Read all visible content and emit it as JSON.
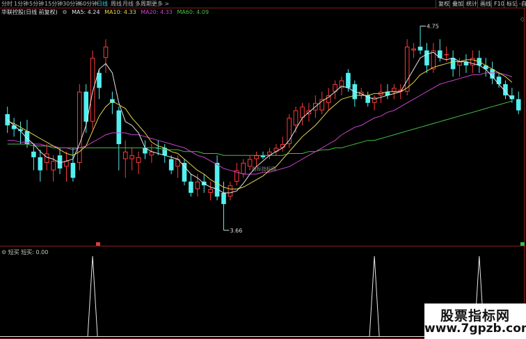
{
  "toolbar": {
    "left_items": [
      {
        "label": "分时",
        "active": false
      },
      {
        "label": "1分钟",
        "active": false
      },
      {
        "label": "5分钟",
        "active": false
      },
      {
        "label": "15分钟",
        "active": false
      },
      {
        "label": "30分钟",
        "active": false
      },
      {
        "label": "60分钟",
        "active": false
      },
      {
        "label": "日线",
        "active": true
      },
      {
        "label": "周线",
        "active": false
      },
      {
        "label": "月线",
        "active": false
      },
      {
        "label": "多周期",
        "active": false
      },
      {
        "label": "更多 >",
        "active": false
      }
    ],
    "right_items": [
      "复权",
      "叠加",
      "统计",
      "画线",
      "F10",
      "标记",
      "-自"
    ]
  },
  "stock": {
    "title": "华联控股(日线 前复权)",
    "ma5": "MA5: 4.24",
    "ma10": "MA10: 4.33",
    "ma20": "MA20: 4.33",
    "ma60": "MA60: 4.09",
    "high_mark": "4.75",
    "low_mark": "3.66"
  },
  "colors": {
    "up": "#ff3b3b",
    "down": "#52f0f0",
    "ma5": "#e6e6e6",
    "ma10": "#e6d84a",
    "ma20": "#cc44cc",
    "ma60": "#44c044",
    "grid": "#8b1a1a"
  },
  "indicator": {
    "name": "短买",
    "legend": "短买: 0.00"
  },
  "watermark_center": "股标指标网",
  "logo": {
    "line1": "股票指标网",
    "line2": "www.7gpzb.com"
  },
  "price_chart": {
    "y_range": [
      3.6,
      4.8
    ],
    "candles": [
      {
        "o": 4.28,
        "h": 4.32,
        "l": 4.18,
        "c": 4.22,
        "up": false
      },
      {
        "o": 4.22,
        "h": 4.26,
        "l": 4.16,
        "c": 4.2,
        "up": false
      },
      {
        "o": 4.2,
        "h": 4.24,
        "l": 4.12,
        "c": 4.19,
        "up": false
      },
      {
        "o": 4.19,
        "h": 4.25,
        "l": 4.1,
        "c": 4.12,
        "up": false
      },
      {
        "o": 4.08,
        "h": 4.12,
        "l": 3.98,
        "c": 4.05,
        "up": false
      },
      {
        "o": 4.05,
        "h": 4.09,
        "l": 3.92,
        "c": 3.98,
        "up": false
      },
      {
        "o": 4.02,
        "h": 4.12,
        "l": 3.98,
        "c": 4.07,
        "up": true
      },
      {
        "o": 3.98,
        "h": 4.06,
        "l": 3.92,
        "c": 4.03,
        "up": true
      },
      {
        "o": 4.06,
        "h": 4.1,
        "l": 3.96,
        "c": 3.99,
        "up": false
      },
      {
        "o": 4.0,
        "h": 4.08,
        "l": 3.92,
        "c": 4.03,
        "up": true
      },
      {
        "o": 4.02,
        "h": 4.1,
        "l": 3.92,
        "c": 3.94,
        "up": false
      },
      {
        "o": 4.02,
        "h": 4.44,
        "l": 3.98,
        "c": 4.4,
        "up": true
      },
      {
        "o": 4.4,
        "h": 4.44,
        "l": 4.18,
        "c": 4.24,
        "up": false
      },
      {
        "o": 4.24,
        "h": 4.62,
        "l": 4.2,
        "c": 4.58,
        "up": true
      },
      {
        "o": 4.5,
        "h": 4.52,
        "l": 4.36,
        "c": 4.42,
        "up": false
      },
      {
        "o": 4.58,
        "h": 4.68,
        "l": 4.5,
        "c": 4.64,
        "up": true
      },
      {
        "o": 4.36,
        "h": 4.4,
        "l": 4.28,
        "c": 4.34,
        "up": false
      },
      {
        "o": 4.3,
        "h": 4.32,
        "l": 3.98,
        "c": 4.12,
        "up": false
      },
      {
        "o": 4.08,
        "h": 4.14,
        "l": 3.94,
        "c": 4.04,
        "up": true
      },
      {
        "o": 4.04,
        "h": 4.1,
        "l": 3.98,
        "c": 4.06,
        "up": true
      },
      {
        "o": 4.02,
        "h": 4.08,
        "l": 3.96,
        "c": 4.05,
        "up": true
      },
      {
        "o": 4.1,
        "h": 4.14,
        "l": 4.04,
        "c": 4.07,
        "up": false
      },
      {
        "o": 4.06,
        "h": 4.12,
        "l": 4.02,
        "c": 4.08,
        "up": true
      },
      {
        "o": 4.1,
        "h": 4.14,
        "l": 4.06,
        "c": 4.1,
        "up": false
      },
      {
        "o": 4.1,
        "h": 4.12,
        "l": 4.02,
        "c": 4.06,
        "up": false
      },
      {
        "o": 4.04,
        "h": 4.06,
        "l": 3.96,
        "c": 3.98,
        "up": false
      },
      {
        "o": 4.0,
        "h": 4.06,
        "l": 3.94,
        "c": 4.04,
        "up": true
      },
      {
        "o": 4.02,
        "h": 4.04,
        "l": 3.9,
        "c": 3.92,
        "up": false
      },
      {
        "o": 3.92,
        "h": 3.96,
        "l": 3.84,
        "c": 3.86,
        "up": false
      },
      {
        "o": 3.88,
        "h": 3.96,
        "l": 3.84,
        "c": 3.92,
        "up": true
      },
      {
        "o": 3.92,
        "h": 3.96,
        "l": 3.86,
        "c": 3.9,
        "up": false
      },
      {
        "o": 3.88,
        "h": 3.92,
        "l": 3.82,
        "c": 3.86,
        "up": true
      },
      {
        "o": 4.02,
        "h": 4.06,
        "l": 3.82,
        "c": 3.84,
        "up": false
      },
      {
        "o": 3.86,
        "h": 3.92,
        "l": 3.66,
        "c": 3.8,
        "up": false
      },
      {
        "o": 3.84,
        "h": 3.92,
        "l": 3.82,
        "c": 3.9,
        "up": true
      },
      {
        "o": 3.92,
        "h": 4.02,
        "l": 3.9,
        "c": 3.98,
        "up": true
      },
      {
        "o": 3.96,
        "h": 4.04,
        "l": 3.94,
        "c": 4.02,
        "up": true
      },
      {
        "o": 4.0,
        "h": 4.06,
        "l": 3.98,
        "c": 4.04,
        "up": true
      },
      {
        "o": 4.04,
        "h": 4.08,
        "l": 4.0,
        "c": 4.06,
        "up": true
      },
      {
        "o": 4.06,
        "h": 4.08,
        "l": 4.04,
        "c": 4.05,
        "up": false
      },
      {
        "o": 4.06,
        "h": 4.1,
        "l": 4.04,
        "c": 4.08,
        "up": true
      },
      {
        "o": 4.08,
        "h": 4.12,
        "l": 4.06,
        "c": 4.1,
        "up": true
      },
      {
        "o": 4.1,
        "h": 4.16,
        "l": 4.08,
        "c": 4.12,
        "up": true
      },
      {
        "o": 4.12,
        "h": 4.28,
        "l": 4.1,
        "c": 4.26,
        "up": true
      },
      {
        "o": 4.22,
        "h": 4.32,
        "l": 4.18,
        "c": 4.3,
        "up": true
      },
      {
        "o": 4.26,
        "h": 4.34,
        "l": 4.22,
        "c": 4.32,
        "up": true
      },
      {
        "o": 4.28,
        "h": 4.34,
        "l": 4.24,
        "c": 4.3,
        "up": true
      },
      {
        "o": 4.3,
        "h": 4.38,
        "l": 4.26,
        "c": 4.34,
        "up": true
      },
      {
        "o": 4.3,
        "h": 4.4,
        "l": 4.28,
        "c": 4.36,
        "up": true
      },
      {
        "o": 4.34,
        "h": 4.42,
        "l": 4.3,
        "c": 4.38,
        "up": true
      },
      {
        "o": 4.4,
        "h": 4.46,
        "l": 4.36,
        "c": 4.44,
        "up": true
      },
      {
        "o": 4.42,
        "h": 4.48,
        "l": 4.38,
        "c": 4.46,
        "up": true
      },
      {
        "o": 4.5,
        "h": 4.52,
        "l": 4.4,
        "c": 4.42,
        "up": false
      },
      {
        "o": 4.44,
        "h": 4.46,
        "l": 4.32,
        "c": 4.36,
        "up": false
      },
      {
        "o": 4.4,
        "h": 4.42,
        "l": 4.36,
        "c": 4.38,
        "up": true
      },
      {
        "o": 4.38,
        "h": 4.4,
        "l": 4.32,
        "c": 4.34,
        "up": false
      },
      {
        "o": 4.34,
        "h": 4.38,
        "l": 4.3,
        "c": 4.37,
        "up": true
      },
      {
        "o": 4.38,
        "h": 4.44,
        "l": 4.34,
        "c": 4.4,
        "up": true
      },
      {
        "o": 4.4,
        "h": 4.44,
        "l": 4.36,
        "c": 4.38,
        "up": false
      },
      {
        "o": 4.4,
        "h": 4.44,
        "l": 4.36,
        "c": 4.42,
        "up": true
      },
      {
        "o": 4.4,
        "h": 4.44,
        "l": 4.36,
        "c": 4.41,
        "up": true
      },
      {
        "o": 4.4,
        "h": 4.68,
        "l": 4.38,
        "c": 4.64,
        "up": true
      },
      {
        "o": 4.62,
        "h": 4.66,
        "l": 4.58,
        "c": 4.63,
        "up": true
      },
      {
        "o": 4.64,
        "h": 4.75,
        "l": 4.6,
        "c": 4.62,
        "up": false
      },
      {
        "o": 4.62,
        "h": 4.66,
        "l": 4.5,
        "c": 4.54,
        "up": false
      },
      {
        "o": 4.52,
        "h": 4.66,
        "l": 4.5,
        "c": 4.62,
        "up": true
      },
      {
        "o": 4.62,
        "h": 4.68,
        "l": 4.56,
        "c": 4.58,
        "up": false
      },
      {
        "o": 4.6,
        "h": 4.64,
        "l": 4.56,
        "c": 4.6,
        "up": true
      },
      {
        "o": 4.58,
        "h": 4.62,
        "l": 4.48,
        "c": 4.52,
        "up": false
      },
      {
        "o": 4.54,
        "h": 4.58,
        "l": 4.48,
        "c": 4.56,
        "up": true
      },
      {
        "o": 4.56,
        "h": 4.6,
        "l": 4.5,
        "c": 4.54,
        "up": false
      },
      {
        "o": 4.54,
        "h": 4.62,
        "l": 4.5,
        "c": 4.58,
        "up": true
      },
      {
        "o": 4.58,
        "h": 4.62,
        "l": 4.5,
        "c": 4.54,
        "up": false
      },
      {
        "o": 4.54,
        "h": 4.58,
        "l": 4.48,
        "c": 4.52,
        "up": false
      },
      {
        "o": 4.52,
        "h": 4.56,
        "l": 4.44,
        "c": 4.47,
        "up": false
      },
      {
        "o": 4.48,
        "h": 4.5,
        "l": 4.42,
        "c": 4.44,
        "up": false
      },
      {
        "o": 4.44,
        "h": 4.46,
        "l": 4.36,
        "c": 4.38,
        "up": false
      },
      {
        "o": 4.38,
        "h": 4.42,
        "l": 4.34,
        "c": 4.36,
        "up": false
      },
      {
        "o": 4.36,
        "h": 4.4,
        "l": 4.28,
        "c": 4.3,
        "up": false
      }
    ],
    "ma5": [
      4.25,
      4.22,
      4.19,
      4.15,
      4.12,
      4.08,
      4.05,
      4.04,
      4.02,
      4.03,
      4.04,
      4.12,
      4.22,
      4.4,
      4.52,
      4.55,
      4.5,
      4.34,
      4.24,
      4.22,
      4.18,
      4.1,
      4.08,
      4.07,
      4.06,
      4.05,
      4.04,
      4.0,
      3.96,
      3.94,
      3.91,
      3.89,
      3.88,
      3.86,
      3.86,
      3.87,
      3.91,
      3.96,
      4.0,
      4.03,
      4.06,
      4.08,
      4.1,
      4.14,
      4.2,
      4.26,
      4.29,
      4.32,
      4.35,
      4.37,
      4.4,
      4.43,
      4.42,
      4.4,
      4.39,
      4.37,
      4.36,
      4.37,
      4.38,
      4.39,
      4.4,
      4.46,
      4.52,
      4.58,
      4.6,
      4.61,
      4.58,
      4.57,
      4.58,
      4.56,
      4.56,
      4.55,
      4.54,
      4.52,
      4.48,
      4.44,
      4.4,
      4.36
    ],
    "ma10": [
      4.24,
      4.23,
      4.21,
      4.19,
      4.17,
      4.15,
      4.13,
      4.11,
      4.09,
      4.07,
      4.06,
      4.08,
      4.11,
      4.19,
      4.27,
      4.32,
      4.35,
      4.33,
      4.31,
      4.26,
      4.22,
      4.18,
      4.13,
      4.11,
      4.1,
      4.08,
      4.07,
      4.04,
      4.01,
      3.98,
      3.96,
      3.93,
      3.91,
      3.89,
      3.88,
      3.88,
      3.89,
      3.91,
      3.93,
      3.95,
      3.98,
      4.0,
      4.04,
      4.08,
      4.12,
      4.16,
      4.19,
      4.22,
      4.26,
      4.3,
      4.33,
      4.36,
      4.37,
      4.38,
      4.38,
      4.38,
      4.39,
      4.39,
      4.4,
      4.4,
      4.4,
      4.42,
      4.45,
      4.49,
      4.51,
      4.53,
      4.54,
      4.55,
      4.56,
      4.56,
      4.57,
      4.57,
      4.56,
      4.54,
      4.52,
      4.5,
      4.48,
      4.45
    ],
    "ma20": [
      4.14,
      4.14,
      4.13,
      4.13,
      4.12,
      4.12,
      4.11,
      4.11,
      4.1,
      4.1,
      4.09,
      4.1,
      4.11,
      4.13,
      4.15,
      4.17,
      4.18,
      4.18,
      4.18,
      4.17,
      4.17,
      4.16,
      4.15,
      4.14,
      4.13,
      4.12,
      4.11,
      4.1,
      4.08,
      4.06,
      4.05,
      4.03,
      4.01,
      3.99,
      3.98,
      3.97,
      3.96,
      3.96,
      3.96,
      3.97,
      3.97,
      3.98,
      3.99,
      4.0,
      4.02,
      4.04,
      4.06,
      4.08,
      4.1,
      4.12,
      4.14,
      4.17,
      4.19,
      4.21,
      4.22,
      4.24,
      4.26,
      4.27,
      4.29,
      4.3,
      4.32,
      4.34,
      4.36,
      4.38,
      4.4,
      4.42,
      4.44,
      4.45,
      4.46,
      4.47,
      4.48,
      4.49,
      4.49,
      4.5,
      4.5,
      4.5,
      4.49,
      4.48
    ],
    "ma60": [
      4.12,
      4.12,
      4.12,
      4.12,
      4.11,
      4.11,
      4.11,
      4.1,
      4.1,
      4.1,
      4.1,
      4.1,
      4.1,
      4.1,
      4.1,
      4.1,
      4.1,
      4.1,
      4.1,
      4.1,
      4.1,
      4.1,
      4.1,
      4.1,
      4.09,
      4.09,
      4.09,
      4.08,
      4.08,
      4.08,
      4.07,
      4.07,
      4.07,
      4.06,
      4.06,
      4.06,
      4.06,
      4.06,
      4.06,
      4.06,
      4.06,
      4.06,
      4.06,
      4.07,
      4.07,
      4.07,
      4.08,
      4.08,
      4.09,
      4.09,
      4.1,
      4.1,
      4.11,
      4.12,
      4.13,
      4.14,
      4.14,
      4.15,
      4.16,
      4.17,
      4.18,
      4.19,
      4.2,
      4.21,
      4.22,
      4.23,
      4.24,
      4.25,
      4.26,
      4.27,
      4.28,
      4.29,
      4.3,
      4.31,
      4.32,
      4.33,
      4.34,
      4.35
    ]
  },
  "signals": [
    {
      "index": 13,
      "value": 1
    },
    {
      "index": 56,
      "value": 1
    },
    {
      "index": 72,
      "value": 1
    }
  ]
}
